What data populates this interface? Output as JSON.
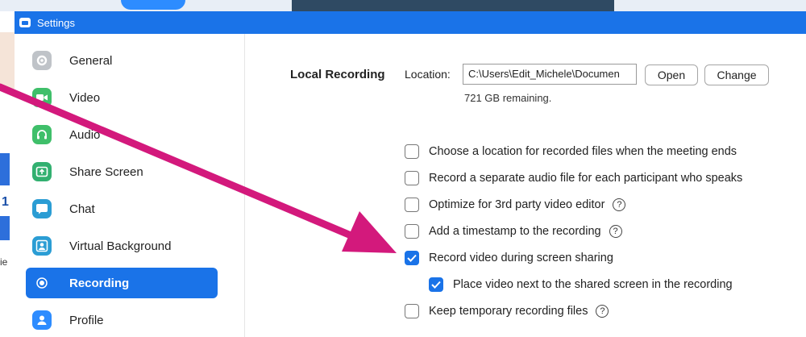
{
  "window": {
    "title": "Settings"
  },
  "sidebar": {
    "items": [
      {
        "label": "General",
        "icon": "gear-icon"
      },
      {
        "label": "Video",
        "icon": "video-camera-icon"
      },
      {
        "label": "Audio",
        "icon": "headphones-icon"
      },
      {
        "label": "Share Screen",
        "icon": "share-screen-icon"
      },
      {
        "label": "Chat",
        "icon": "chat-bubble-icon"
      },
      {
        "label": "Virtual Background",
        "icon": "person-icon"
      },
      {
        "label": "Recording",
        "icon": "record-icon",
        "active": true
      },
      {
        "label": "Profile",
        "icon": "profile-icon"
      }
    ]
  },
  "recording": {
    "section_label": "Local Recording",
    "location_label": "Location:",
    "location_value": "C:\\Users\\Edit_Michele\\Documen",
    "open_label": "Open",
    "change_label": "Change",
    "remaining": "721 GB remaining.",
    "options": [
      {
        "label": "Choose a location for recorded files when the meeting ends",
        "checked": false
      },
      {
        "label": "Record a separate audio file for each participant who speaks",
        "checked": false
      },
      {
        "label": "Optimize for 3rd party video editor",
        "checked": false,
        "help": true
      },
      {
        "label": "Add a timestamp to the recording",
        "checked": false,
        "help": true
      },
      {
        "label": "Record video during screen sharing",
        "checked": true
      },
      {
        "label": "Place video next to the shared screen in the recording",
        "checked": true
      },
      {
        "label": "Keep temporary recording files",
        "checked": false,
        "help": true
      }
    ]
  },
  "colors": {
    "accent": "#1a73e8",
    "arrow": "#d3197c"
  },
  "background": {
    "left_number": "1",
    "left_text": "ie"
  }
}
